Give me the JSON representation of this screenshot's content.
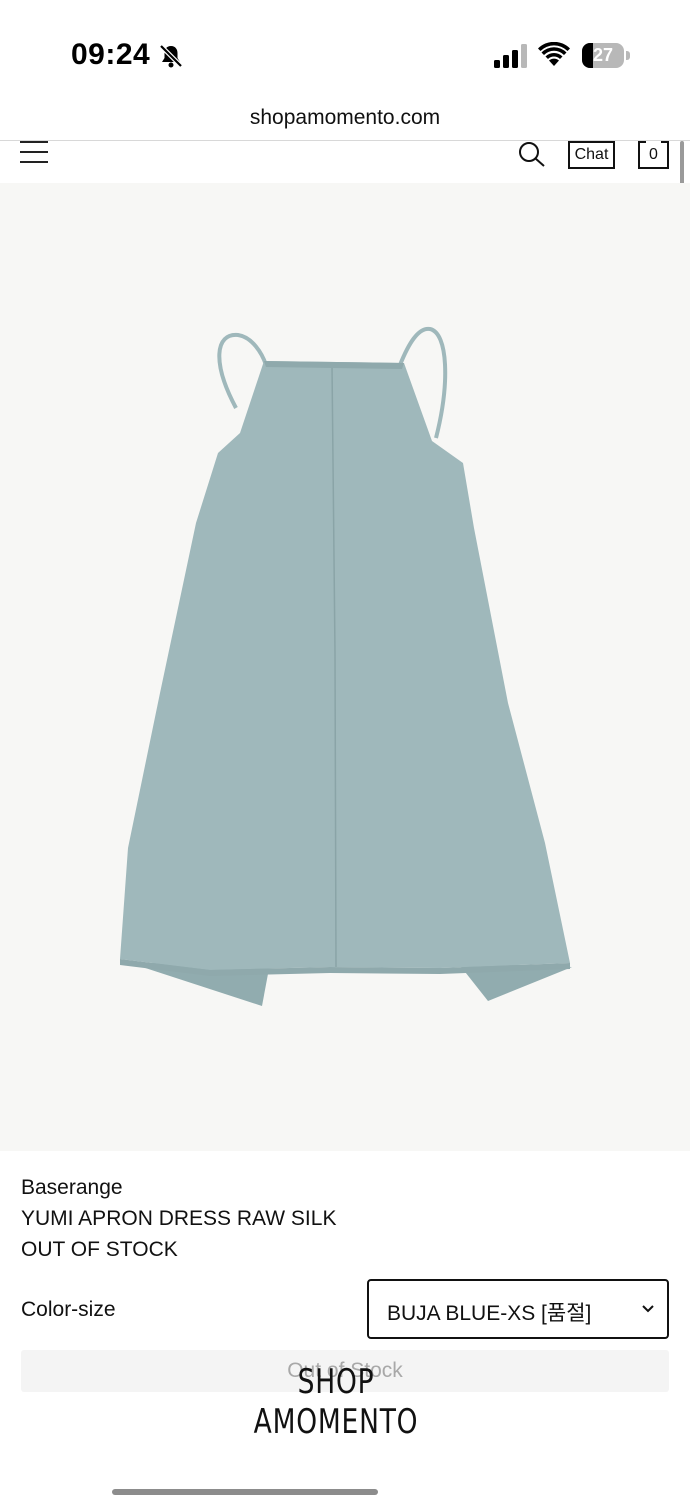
{
  "status_bar": {
    "time": "09:24",
    "battery_level": 27,
    "battery_label": "27",
    "icons": [
      "bell-slash-icon",
      "cellular-signal-icon",
      "wifi-icon",
      "battery-icon"
    ]
  },
  "browser": {
    "url": "shopamomento.com"
  },
  "header": {
    "chat_label": "Chat",
    "cart_count": "0",
    "icons": [
      "menu-icon",
      "search-icon"
    ]
  },
  "product": {
    "brand": "Baserange",
    "name": "YUMI APRON DRESS RAW SILK",
    "availability": "OUT OF STOCK",
    "image_color": "#9fb8bb"
  },
  "options": {
    "label": "Color-size",
    "selected": "BUJA BLUE-XS [품절]"
  },
  "purchase": {
    "button_label": "Out of Stock"
  },
  "logo": {
    "line1": "SHOP",
    "line2": "AMOMENTO"
  },
  "colors": {
    "background": "#ffffff",
    "image_background": "#f7f7f5",
    "text": "#111111",
    "disabled_text": "#a8a8a8"
  }
}
